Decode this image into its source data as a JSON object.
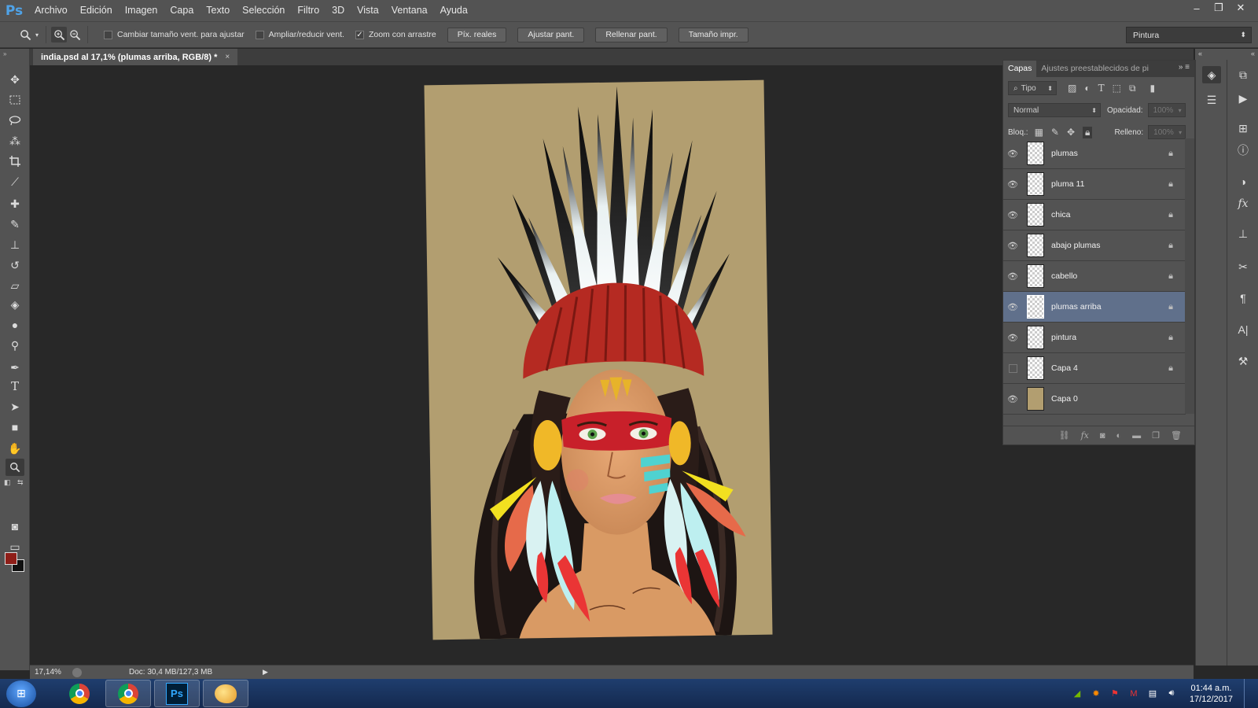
{
  "app": {
    "logo": "Ps"
  },
  "menu": [
    "Archivo",
    "Edición",
    "Imagen",
    "Capa",
    "Texto",
    "Selección",
    "Filtro",
    "3D",
    "Vista",
    "Ventana",
    "Ayuda"
  ],
  "window_controls": {
    "minimize": "–",
    "restore": "❐",
    "close": "✕"
  },
  "options": {
    "resize_windows": {
      "label": "Cambiar tamaño vent. para ajustar",
      "checked": false
    },
    "zoom_all": {
      "label": "Ampliar/reducir vent.",
      "checked": false
    },
    "scrubby_zoom": {
      "label": "Zoom con arrastre",
      "checked": true
    },
    "buttons": [
      "Píx. reales",
      "Ajustar pant.",
      "Rellenar pant.",
      "Tamaño impr."
    ],
    "workspace": "Pintura"
  },
  "document": {
    "tab_title": "india.psd al 17,1% (plumas arriba, RGB/8) *",
    "close": "×"
  },
  "status": {
    "zoom": "17,14%",
    "doc_info": "Doc: 30,4 MB/127,3 MB"
  },
  "colors": {
    "foreground": "#8e1e18",
    "background": "#111111",
    "canvas": "#b29e70"
  },
  "layers_panel": {
    "tabs": [
      "Capas",
      "Ajustes preestablecidos de pi"
    ],
    "filter": "Tipo",
    "blend_mode": "Normal",
    "opacity_label": "Opacidad:",
    "opacity": "100%",
    "lock_label": "Bloq.:",
    "fill_label": "Relleno:",
    "fill": "100%",
    "layers": [
      {
        "name": "plumas",
        "visible": true,
        "locked": true,
        "selected": false
      },
      {
        "name": "pluma 11",
        "visible": true,
        "locked": true,
        "selected": false
      },
      {
        "name": "chica",
        "visible": true,
        "locked": true,
        "selected": false
      },
      {
        "name": "abajo plumas",
        "visible": true,
        "locked": true,
        "selected": false
      },
      {
        "name": "cabello",
        "visible": true,
        "locked": true,
        "selected": false
      },
      {
        "name": "plumas arriba",
        "visible": true,
        "locked": true,
        "selected": true
      },
      {
        "name": "pintura",
        "visible": true,
        "locked": true,
        "selected": false
      },
      {
        "name": "Capa 4",
        "visible": false,
        "locked": true,
        "selected": false
      },
      {
        "name": "Capa 0",
        "visible": true,
        "locked": false,
        "selected": false
      }
    ]
  },
  "taskbar": {
    "time": "01:44 a.m.",
    "date": "17/12/2017"
  }
}
